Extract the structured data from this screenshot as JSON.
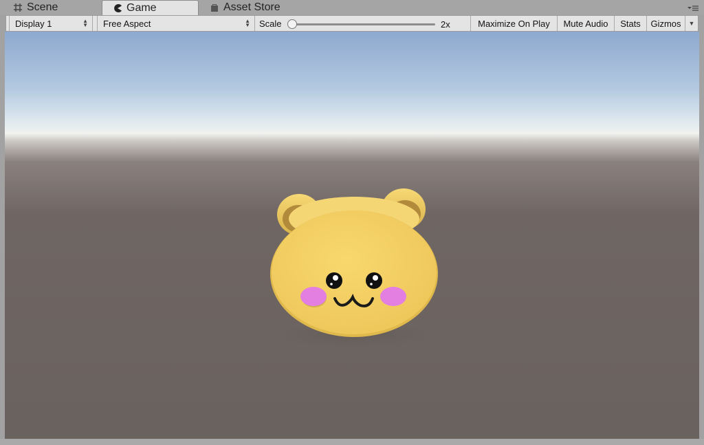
{
  "tabs": [
    {
      "label": "Scene",
      "icon": "grid-icon"
    },
    {
      "label": "Game",
      "icon": "pacman-icon",
      "active": true
    },
    {
      "label": "Asset Store",
      "icon": "store-bag-icon"
    }
  ],
  "toolbar": {
    "display": "Display 1",
    "aspect": "Free Aspect",
    "scale_label": "Scale",
    "scale_value": "2x",
    "maximize": "Maximize On Play",
    "mute": "Mute Audio",
    "stats": "Stats",
    "gizmos": "Gizmos"
  },
  "scene": {
    "character": "yellow bear head",
    "colors": {
      "face": "#f3cf63",
      "ears_inner": "#b28a3c",
      "cheeks": "#e27fe0",
      "eyes": "#111111"
    }
  },
  "colors": {
    "toolbar_bg": "#e4e4e4",
    "tabbar_bg": "#a5a5a5",
    "active_tab": "#e3e3e3"
  }
}
